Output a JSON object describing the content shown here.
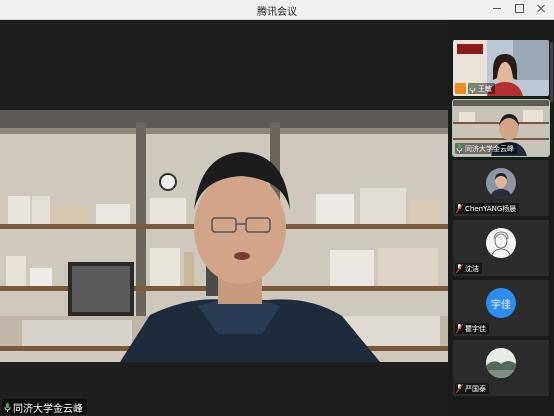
{
  "window": {
    "title": "腾讯会议"
  },
  "main_speaker": {
    "name": "同济大学金云峰"
  },
  "participants": [
    {
      "name": "王敏",
      "active": false,
      "avatar": "photo"
    },
    {
      "name": "同济大学金云峰",
      "active": true,
      "avatar": "photo"
    },
    {
      "name": "ChenYANG杨晨",
      "active": false,
      "avatar": "photo"
    },
    {
      "name": "沈洁",
      "active": false,
      "avatar": "drawing"
    },
    {
      "name": "瞿宇佳",
      "active": false,
      "avatar": "text",
      "avatar_text": "宇佳"
    },
    {
      "name": "严国泰",
      "active": false,
      "avatar": "photo"
    }
  ],
  "colors": {
    "accent_green": "#3bb34a",
    "avatar_blue": "#2d8cf0",
    "share_orange": "#f08a24"
  }
}
